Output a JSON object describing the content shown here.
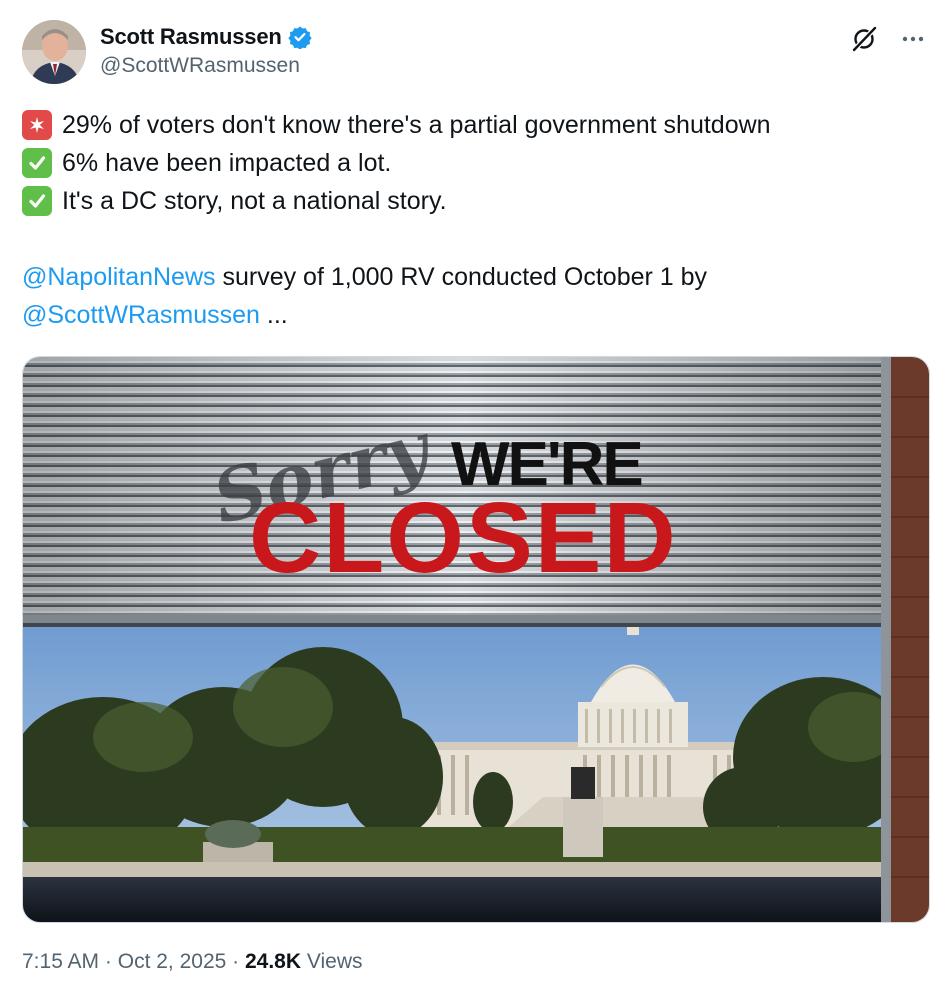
{
  "author": {
    "display_name": "Scott Rasmussen",
    "handle": "@ScottWRasmussen",
    "verified": true,
    "avatar_icon": "avatar-photo"
  },
  "actions": {
    "grok_icon": "grok-icon",
    "more_icon": "more-icon"
  },
  "tweet": {
    "line1": "29% of voters don't know there's a partial government shutdown",
    "line2": "6% have been impacted a lot.",
    "line3": "It's a DC story, not a national story.",
    "line4_mention": "@NapolitanNews",
    "line4_text": " survey of 1,000 RV conducted October 1 by",
    "line5_mention": "@ScottWRasmussen",
    "line5_text": " ...",
    "emoji_1": "siren",
    "emoji_2": "check-mark",
    "emoji_3": "check-mark"
  },
  "media": {
    "sign_script": "Sorry",
    "sign_were": "WE'RE",
    "sign_closed": "CLOSED"
  },
  "meta": {
    "time": "7:15 AM",
    "separator": " · ",
    "date": "Oct 2, 2025",
    "views_count": "24.8K",
    "views_label": " Views"
  },
  "colors": {
    "link": "#1d9bf0",
    "secondary_text": "#536471",
    "verified_badge": "#1d9bf0",
    "closed_red": "#c8181b"
  }
}
